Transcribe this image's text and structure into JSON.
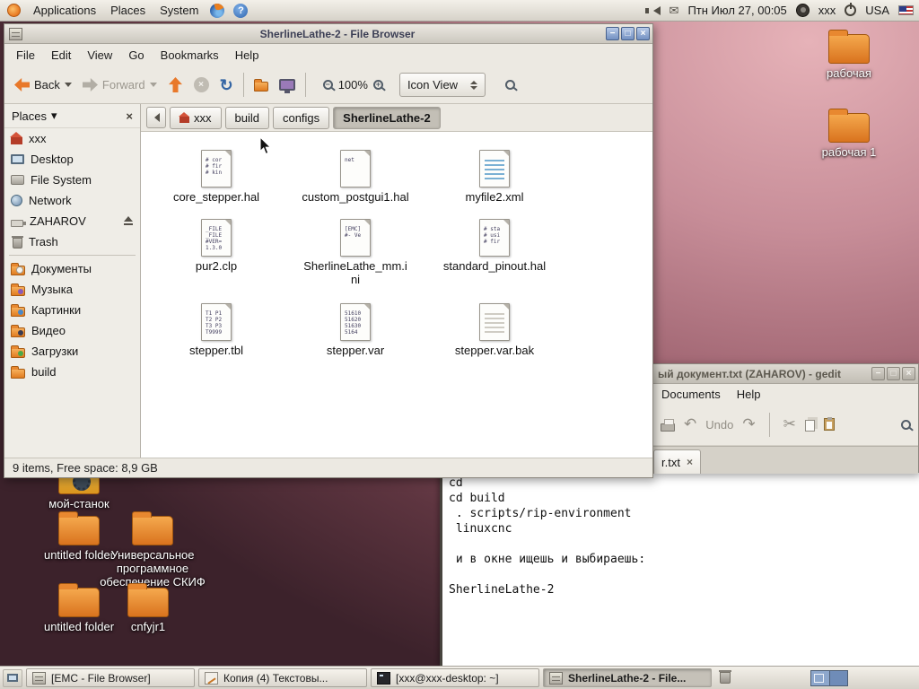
{
  "icons": {
    "help": "?",
    "mail": "✉",
    "refresh": "↻",
    "undo": "↶",
    "redo": "↷",
    "cut": "✂",
    "minimize": "−",
    "maximize": "□",
    "close": "×",
    "caret": "▾",
    "zoom_out": "−",
    "zoom_in": "+"
  },
  "colors": {
    "accent_orange": "#e8782a",
    "titlebar_button_blue": "#7391c2",
    "workspace_blue": "#6f8cb8"
  },
  "top_panel": {
    "menus": [
      "Applications",
      "Places",
      "System"
    ],
    "clock": "Птн Июл 27, 00:05",
    "user": "xxx",
    "layout": "USA"
  },
  "file_browser": {
    "title": "SherlineLathe-2 - File Browser",
    "menus": [
      "File",
      "Edit",
      "View",
      "Go",
      "Bookmarks",
      "Help"
    ],
    "toolbar": {
      "back": "Back",
      "forward": "Forward",
      "zoom_level": "100%",
      "view_mode": "Icon View"
    },
    "path": [
      "xxx",
      "build",
      "configs",
      "SherlineLathe-2"
    ],
    "sidebar": {
      "title": "Places",
      "items": [
        "xxx",
        "Desktop",
        "File System",
        "Network",
        "ZAHAROV",
        "Trash",
        "Документы",
        "Музыка",
        "Картинки",
        "Видео",
        "Загрузки",
        "build"
      ]
    },
    "files": [
      {
        "name": "core_stepper.hal",
        "icon": "ficon text",
        "preview": [
          "# cor",
          "# fir",
          "# kin",
          ""
        ]
      },
      {
        "name": "custom_postgui1.hal",
        "icon": "ficon text",
        "preview": [
          "",
          "",
          "net",
          ""
        ]
      },
      {
        "name": "myfile2.xml",
        "icon": "ficon xml",
        "preview": [
          "",
          "",
          "",
          ""
        ]
      },
      {
        "name": "pur2.clp",
        "icon": "ficon text",
        "preview": [
          "_FILE",
          "_FILE",
          "#VER=",
          "1.3.0"
        ]
      },
      {
        "name": "SherlineLathe_mm.ini",
        "icon": "ficon text",
        "preview": [
          "[EMC]",
          "",
          "#- Ve",
          ""
        ]
      },
      {
        "name": "standard_pinout.hal",
        "icon": "ficon text",
        "preview": [
          "# sta",
          "# usi",
          "# fir",
          ""
        ]
      },
      {
        "name": "stepper.tbl",
        "icon": "ficon text",
        "preview": [
          "T1 P1",
          "T2 P2",
          "T3 P3",
          "T9999"
        ]
      },
      {
        "name": "stepper.var",
        "icon": "ficon text",
        "preview": [
          "51610",
          "51620",
          "51630",
          "5164"
        ]
      },
      {
        "name": "stepper.var.bak",
        "icon": "ficon plain",
        "preview": [
          "",
          "",
          "",
          ""
        ]
      }
    ],
    "status": "9 items, Free space: 8,9 GB"
  },
  "desktop": {
    "right_icons": [
      "рабочая",
      "рабочая 1"
    ],
    "left_icons": [
      "мой-станок",
      "untitled folder",
      "Универсальное программное обеспечение СКИФ",
      "untitled folder",
      "cnfyjr1"
    ]
  },
  "gedit": {
    "title": "ый документ.txt (ZAHAROV) - gedit",
    "menus": [
      "Documents",
      "Help"
    ],
    "undo_label": "Undo",
    "tab": "r.txt"
  },
  "terminal": {
    "lines": [
      "cd",
      "cd build",
      " . scripts/rip-environment",
      " linuxcnc",
      "",
      " и в окне ищешь и выбираешь:",
      "",
      "SherlineLathe-2"
    ]
  },
  "taskbar": {
    "buttons": [
      "[EMC - File Browser]",
      "Копия (4) Текстовы...",
      "[xxx@xxx-desktop: ~]",
      "SherlineLathe-2 - File..."
    ]
  }
}
